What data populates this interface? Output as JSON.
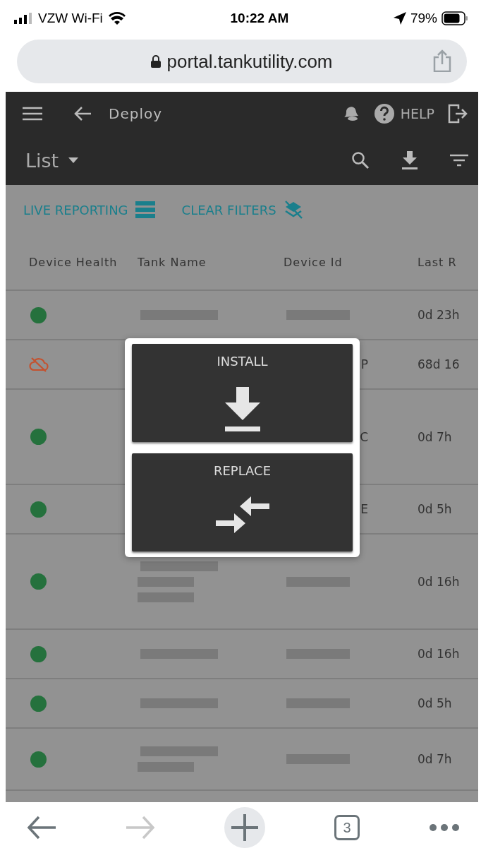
{
  "status_bar": {
    "carrier": "VZW Wi-Fi",
    "time": "10:22 AM",
    "battery": "79%"
  },
  "address_bar": {
    "url": "portal.tankutility.com"
  },
  "app_bar": {
    "title": "Deploy",
    "help": "HELP"
  },
  "view_bar": {
    "view": "List"
  },
  "filters": [
    {
      "label": "LIVE REPORTING",
      "kind": "reporting"
    },
    {
      "label": "CLEAR FILTERS",
      "kind": "clear"
    }
  ],
  "table": {
    "columns": [
      "Device Health",
      "Tank Name",
      "Device Id",
      "Last R"
    ],
    "rows": [
      {
        "online": true,
        "last": "0d 23h"
      },
      {
        "online": false,
        "last": "68d 16",
        "device_id_tail": "P"
      },
      {
        "online": true,
        "last": "0d 7h",
        "device_id_tail": "C"
      },
      {
        "online": true,
        "last": "0d 5h",
        "device_id_tail": "E"
      },
      {
        "online": true,
        "last": "0d 16h"
      },
      {
        "online": true,
        "last": "0d 16h"
      },
      {
        "online": true,
        "last": "0d 5h"
      },
      {
        "online": true,
        "last": "0d 7h"
      }
    ]
  },
  "dialog": {
    "options": [
      {
        "label": "INSTALL",
        "kind": "install"
      },
      {
        "label": "REPLACE",
        "kind": "replace"
      }
    ]
  },
  "browser_toolbar": {
    "tabs": "3"
  }
}
